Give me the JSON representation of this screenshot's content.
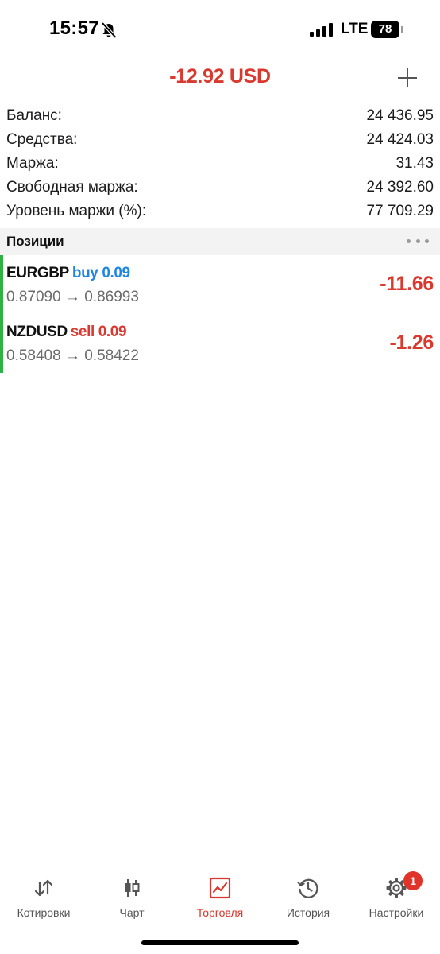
{
  "status_bar": {
    "time": "15:57",
    "network": "LTE",
    "battery": "78"
  },
  "header": {
    "total_profit": "-12.92 USD",
    "add_icon": "plus-icon"
  },
  "summary": {
    "rows": [
      {
        "label": "Баланс:",
        "value": "24 436.95"
      },
      {
        "label": "Средства:",
        "value": "24 424.03"
      },
      {
        "label": "Маржа:",
        "value": "31.43"
      },
      {
        "label": "Свободная маржа:",
        "value": "24 392.60"
      },
      {
        "label": "Уровень маржи (%):",
        "value": "77 709.29"
      }
    ]
  },
  "positions": {
    "title": "Позиции",
    "items": [
      {
        "symbol": "EURGBP",
        "direction": "buy 0.09",
        "prices": "0.87090 → 0.86993",
        "profit": "-11.66"
      },
      {
        "symbol": "NZDUSD",
        "direction": "sell 0.09",
        "prices": "0.58408 → 0.58422",
        "profit": "-1.26"
      }
    ]
  },
  "tab_bar": {
    "tabs": [
      {
        "label": "Котировки",
        "icon": "quotes-arrows-icon"
      },
      {
        "label": "Чарт",
        "icon": "candlestick-chart-icon"
      },
      {
        "label": "Торговля",
        "icon": "trade-chart-icon"
      },
      {
        "label": "История",
        "icon": "history-clock-icon"
      },
      {
        "label": "Настройки",
        "icon": "gear-icon"
      }
    ],
    "active": "Торговля",
    "settings_badge": "1"
  },
  "colors": {
    "loss_red": "#d9392e",
    "buy_blue": "#1e86e4",
    "position_bar_green": "#2db244"
  }
}
